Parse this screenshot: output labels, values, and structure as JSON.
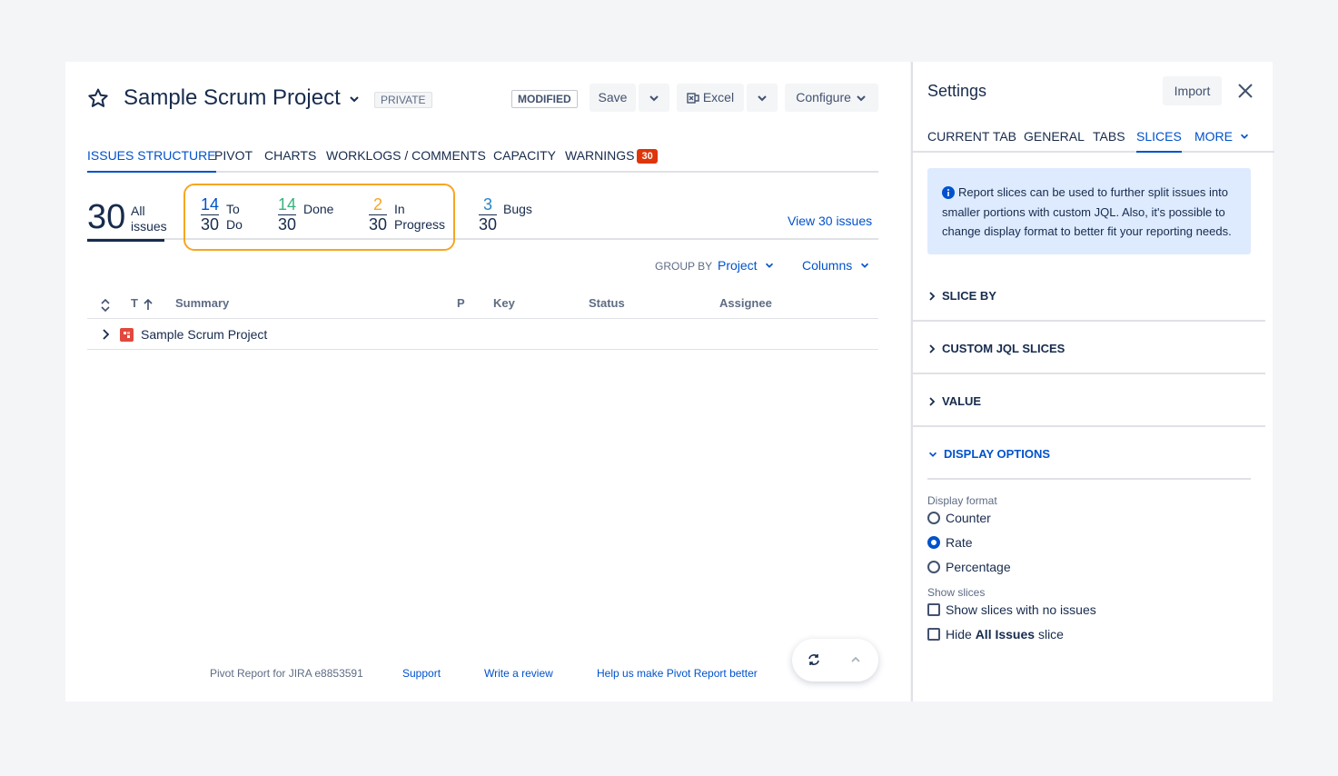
{
  "header": {
    "title": "Sample Scrum Project",
    "visibility": "PRIVATE",
    "state": "MODIFIED",
    "save_label": "Save",
    "excel_label": "Excel",
    "configure_label": "Configure"
  },
  "tabs": [
    {
      "label": "ISSUES STRUCTURE",
      "active": true
    },
    {
      "label": "PIVOT"
    },
    {
      "label": "CHARTS"
    },
    {
      "label": "WORKLOGS / COMMENTS"
    },
    {
      "label": "CAPACITY"
    },
    {
      "label": "WARNINGS"
    }
  ],
  "warnings_count": "30",
  "counters": {
    "all": {
      "value": "30",
      "label1": "All",
      "label2": "issues"
    },
    "todo": {
      "num": "14",
      "den": "30",
      "label1": "To",
      "label2": "Do",
      "color": "#0052cc"
    },
    "done": {
      "num": "14",
      "den": "30",
      "label1": "Done",
      "color": "#36b37e"
    },
    "inprogress": {
      "num": "2",
      "den": "30",
      "label1": "In",
      "label2": "Progress",
      "color": "#f5a623"
    },
    "bugs": {
      "num": "3",
      "den": "30",
      "label1": "Bugs",
      "color": "#2684c8"
    },
    "view_link": "View 30 issues"
  },
  "grouping": {
    "label": "GROUP BY",
    "value": "Project",
    "columns_label": "Columns"
  },
  "table": {
    "headers": {
      "type": "T",
      "summary": "Summary",
      "priority": "P",
      "key": "Key",
      "status": "Status",
      "assignee": "Assignee"
    },
    "rows": [
      {
        "summary": "Sample Scrum Project"
      }
    ]
  },
  "footer": {
    "version": "Pivot Report for JIRA e8853591",
    "support": "Support",
    "review": "Write a review",
    "feedback": "Help us make Pivot Report better"
  },
  "settings": {
    "title": "Settings",
    "import_label": "Import",
    "tabs": [
      {
        "label": "CURRENT TAB"
      },
      {
        "label": "GENERAL"
      },
      {
        "label": "TABS"
      },
      {
        "label": "SLICES",
        "active": true
      },
      {
        "label": "MORE"
      }
    ],
    "info": "Report slices can be used to further split issues into smaller portions with custom JQL. Also, it's possible to change display format to better fit your reporting needs.",
    "sections": {
      "slice_by": "SLICE BY",
      "custom_jql": "CUSTOM JQL SLICES",
      "value": "VALUE",
      "display_options": "DISPLAY OPTIONS"
    },
    "display_format_label": "Display format",
    "format_options": [
      {
        "label": "Counter",
        "selected": false
      },
      {
        "label": "Rate",
        "selected": true
      },
      {
        "label": "Percentage",
        "selected": false
      }
    ],
    "show_slices_label": "Show slices",
    "show_no_issues": "Show slices with no issues",
    "hide_prefix": "Hide ",
    "hide_bold": "All Issues",
    "hide_suffix": " slice"
  }
}
